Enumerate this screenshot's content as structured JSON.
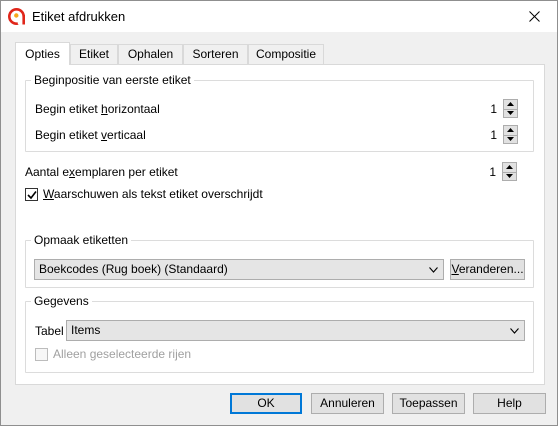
{
  "window": {
    "title": "Etiket afdrukken",
    "close_icon": "close-icon",
    "app_icon": "banana-app-icon"
  },
  "tabs": [
    {
      "label": "Opties",
      "active": true
    },
    {
      "label": "Etiket"
    },
    {
      "label": "Ophalen"
    },
    {
      "label": "Sorteren"
    },
    {
      "label": "Compositie"
    }
  ],
  "start_position": {
    "title": "Beginpositie van eerste etiket",
    "horizontal": {
      "label_pre": "Begin etiket ",
      "label_u": "h",
      "label_post": "orizontaal",
      "value": "1"
    },
    "vertical": {
      "label_pre": "Begin etiket ",
      "label_u": "v",
      "label_post": "erticaal",
      "value": "1"
    }
  },
  "copies": {
    "label_pre": "Aantal e",
    "label_u": "x",
    "label_post": "emplaren per etiket",
    "value": "1"
  },
  "warn": {
    "label_u": "W",
    "label_post": "aarschuwen als tekst etiket overschrijdt",
    "checked": true
  },
  "format": {
    "title": "Opmaak etiketten",
    "selected": "Boekcodes (Rug boek) (Standaard)",
    "change_u": "V",
    "change_post": "eranderen..."
  },
  "data": {
    "title": "Gegevens",
    "table_label": "Tabel",
    "table_value": "Items",
    "selected_rows_label": "Alleen geselecteerde rijen",
    "selected_rows_checked": false
  },
  "buttons": {
    "ok": "OK",
    "cancel": "Annuleren",
    "apply": "Toepassen",
    "help": "Help"
  },
  "colors": {
    "accent": "#0078d7",
    "app_icon_red": "#e0261a"
  }
}
